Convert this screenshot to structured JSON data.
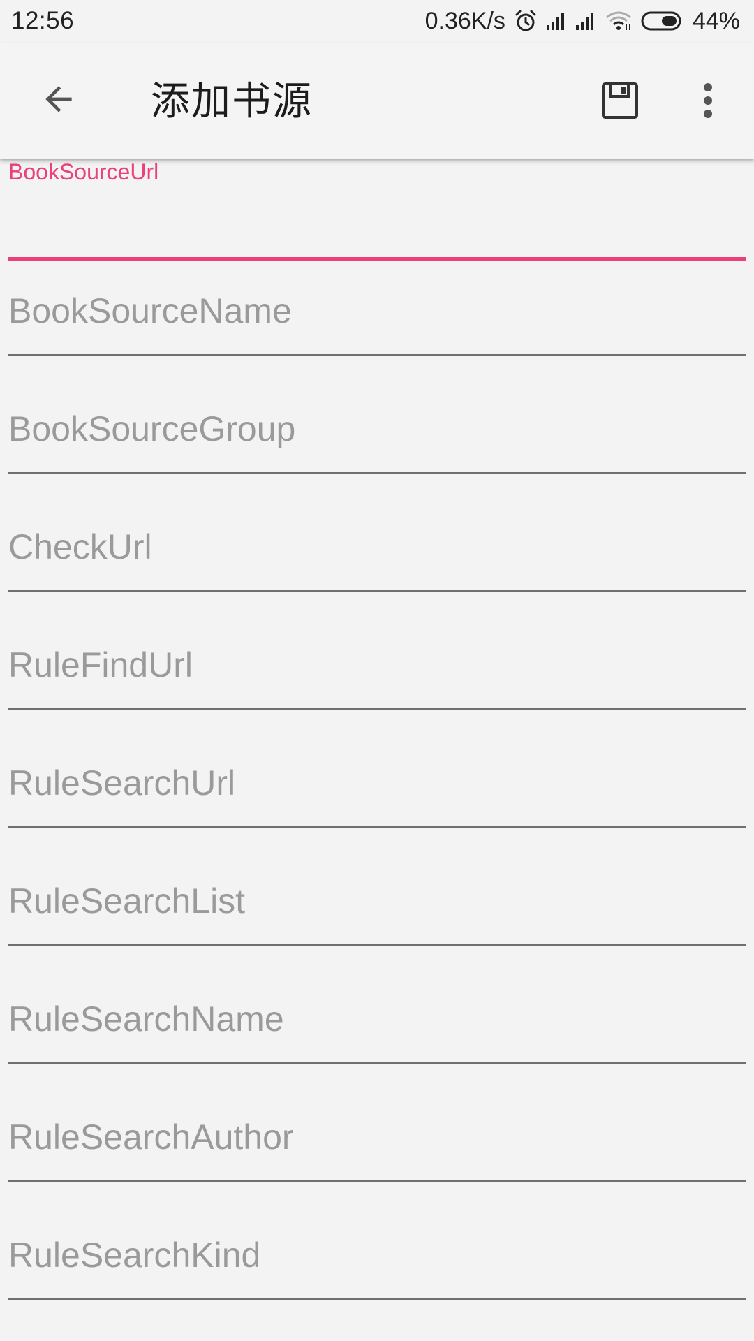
{
  "status_bar": {
    "time": "12:56",
    "net_speed": "0.36K/s",
    "battery": "44%",
    "icons": [
      "alarm-icon",
      "signal-icon",
      "signal-icon",
      "wifi-icon",
      "battery-icon"
    ]
  },
  "app_bar": {
    "title": "添加书源",
    "back_icon": "arrow-back-icon",
    "save_icon": "save-icon",
    "more_icon": "more-vert-icon"
  },
  "form": {
    "fields": [
      {
        "label": "BookSourceUrl",
        "value": "",
        "focused": true
      },
      {
        "placeholder": "BookSourceName",
        "value": ""
      },
      {
        "placeholder": "BookSourceGroup",
        "value": ""
      },
      {
        "placeholder": "CheckUrl",
        "value": ""
      },
      {
        "placeholder": "RuleFindUrl",
        "value": ""
      },
      {
        "placeholder": "RuleSearchUrl",
        "value": ""
      },
      {
        "placeholder": "RuleSearchList",
        "value": ""
      },
      {
        "placeholder": "RuleSearchName",
        "value": ""
      },
      {
        "placeholder": "RuleSearchAuthor",
        "value": ""
      },
      {
        "placeholder": "RuleSearchKind",
        "value": ""
      }
    ]
  },
  "colors": {
    "accent": "#ec407a",
    "background": "#f3f3f3",
    "placeholder": "#9a9a9a",
    "underline": "#6f6f6f"
  }
}
